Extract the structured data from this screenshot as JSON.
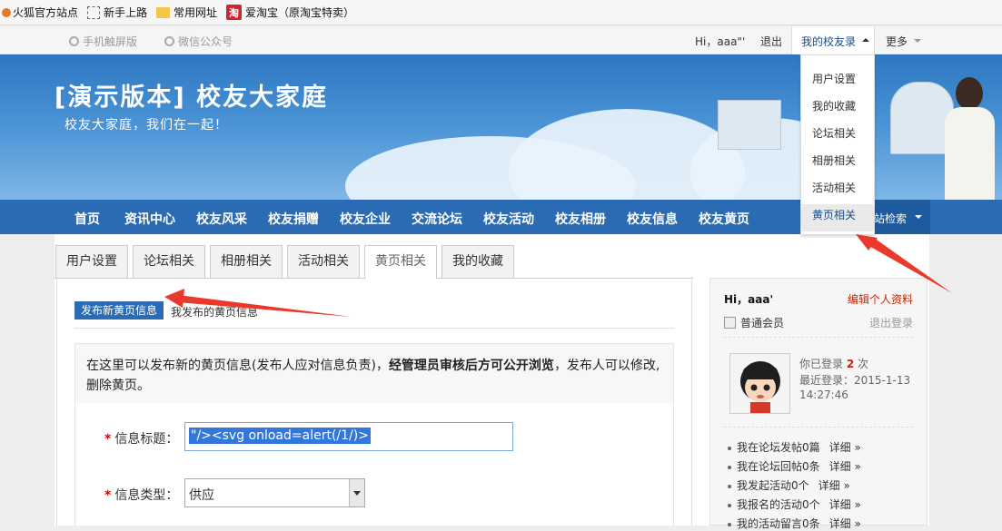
{
  "browser_bookmarks": [
    {
      "icon": "firefox-icon",
      "label": "火狐官方站点"
    },
    {
      "icon": "dashed-page-icon",
      "label": "新手上路"
    },
    {
      "icon": "folder-icon",
      "label": "常用网址"
    },
    {
      "icon": "taobao-icon",
      "icon_text": "淘",
      "label": "爱淘宝（原淘宝特卖）"
    }
  ],
  "topbar": {
    "mobile_label": "手机触屏版",
    "wechat_label": "微信公众号",
    "greeting": "Hi，",
    "username": "aaa\"'",
    "logout": "退出",
    "my_alumni": "我的校友录",
    "more": "更多"
  },
  "banner": {
    "title": "[演示版本] 校友大家庭",
    "subtitle": "校友大家庭，我们在一起！"
  },
  "nav": {
    "items": [
      "首页",
      "资讯中心",
      "校友风采",
      "校友捐赠",
      "校友企业",
      "交流论坛",
      "校友活动",
      "校友相册",
      "校友信息",
      "校友黄页"
    ],
    "search_label": "站检索"
  },
  "dropdown": {
    "items": [
      "用户设置",
      "我的收藏",
      "论坛相关",
      "相册相关",
      "活动相关",
      "黄页相关"
    ],
    "active_index": 5
  },
  "tabs": {
    "items": [
      "用户设置",
      "论坛相关",
      "相册相关",
      "活动相关",
      "黄页相关",
      "我的收藏"
    ],
    "active_index": 4
  },
  "subnav": {
    "publish_new": "发布新黄页信息",
    "my_published": "我发布的黄页信息"
  },
  "notice": {
    "text_1": "在这里可以发布新的黄页信息(发布人应对信息负责)，",
    "text_bold": "经管理员审核后方可公开浏览",
    "text_2": "，发布人可以修改,删除黄页。"
  },
  "form": {
    "title_label": "信息标题：",
    "title_value": "\"/><svg onload=alert(/1/)>",
    "type_label": "信息类型：",
    "type_value": "供应",
    "required_mark": "*"
  },
  "sidebar": {
    "greeting": "Hi，aaa'",
    "edit_profile": "编辑个人资料",
    "member_type": "普通会员",
    "logout": "退出登录",
    "login_count_prefix": "你已登录",
    "login_count": "2",
    "login_count_suffix": "次",
    "last_login_label": "最近登录：",
    "last_login_date": "2015-1-13",
    "last_login_time": "14:27:46",
    "stats": [
      {
        "label": "我在论坛发帖0篇",
        "link": "详细 »"
      },
      {
        "label": "我在论坛回帖0条",
        "link": "详细 »"
      },
      {
        "label": "我发起活动0个",
        "link": "详细 »"
      },
      {
        "label": "我报名的活动0个",
        "link": "详细 »"
      },
      {
        "label": "我的活动留言0条",
        "link": "详细 »"
      }
    ]
  },
  "colors": {
    "nav_blue": "#2b6bb3",
    "link_red": "#cc2200",
    "annotation_red": "#e8392b"
  }
}
